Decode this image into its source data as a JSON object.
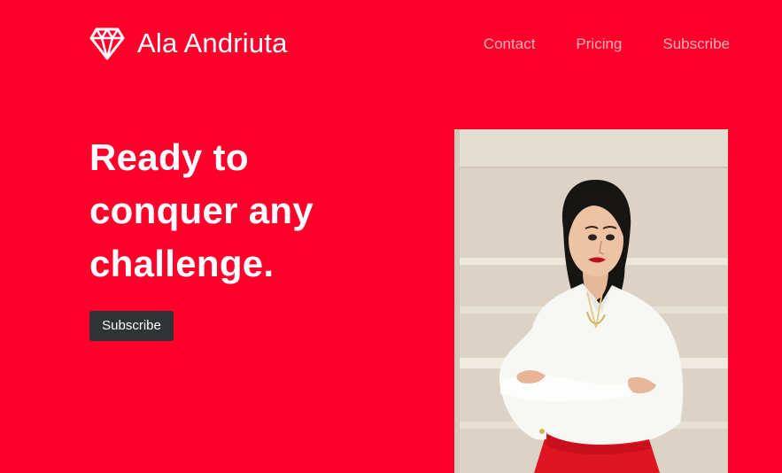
{
  "brand": {
    "name": "Ala Andriuta",
    "icon": "diamond-icon"
  },
  "nav": {
    "items": [
      {
        "label": "Contact"
      },
      {
        "label": "Pricing"
      },
      {
        "label": "Subscribe"
      }
    ]
  },
  "hero": {
    "title_lines": [
      "Ready to",
      "conquer any",
      "challenge."
    ],
    "cta_label": "Subscribe"
  },
  "colors": {
    "background": "#ff002b",
    "button": "#2f3337",
    "text": "#ffffff"
  }
}
